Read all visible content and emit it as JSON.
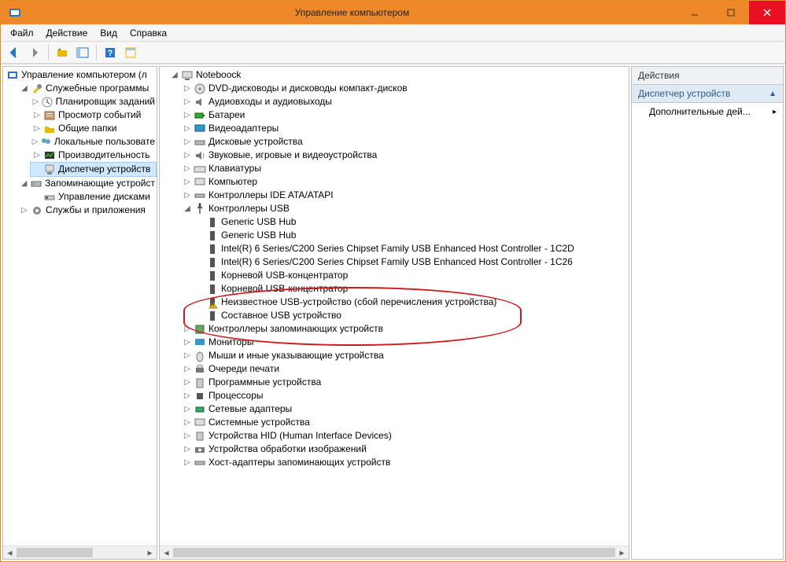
{
  "window": {
    "title": "Управление компьютером"
  },
  "menubar": {
    "file": "Файл",
    "action": "Действие",
    "view": "Вид",
    "help": "Справка"
  },
  "left_tree": {
    "root": "Управление компьютером (л",
    "sys_tools": "Служебные программы",
    "scheduler": "Планировщик заданий",
    "eventviewer": "Просмотр событий",
    "shared": "Общие папки",
    "localusers": "Локальные пользовате",
    "perf": "Производительность",
    "devmgr": "Диспетчер устройств",
    "storage": "Запоминающие устройст",
    "diskmgmt": "Управление дисками",
    "services": "Службы и приложения"
  },
  "device_tree": {
    "root": "Noteboock",
    "dvd": "DVD-дисководы и дисководы компакт-дисков",
    "audio": "Аудиовходы и аудиовыходы",
    "battery": "Батареи",
    "video": "Видеоадаптеры",
    "disk": "Дисковые устройства",
    "sound": "Звуковые, игровые и видеоустройства",
    "keyboard": "Клавиатуры",
    "computer": "Компьютер",
    "ide": "Контроллеры IDE ATA/ATAPI",
    "usb": "Контроллеры USB",
    "usb_items": {
      "hub1": "Generic USB Hub",
      "hub2": "Generic USB Hub",
      "intel1": "Intel(R) 6 Series/C200 Series Chipset Family USB Enhanced Host Controller - 1C2D",
      "intel2": "Intel(R) 6 Series/C200 Series Chipset Family USB Enhanced Host Controller - 1C26",
      "roothub1": "Корневой USB-концентратор",
      "roothub2": "Корневой USB-концентратор",
      "unknown": "Неизвестное USB-устройство (сбой перечисления устройства)",
      "composite": "Составное USB устройство"
    },
    "storagectrl": "Контроллеры запоминающих устройств",
    "monitors": "Мониторы",
    "mice": "Мыши и иные указывающие устройства",
    "printq": "Очереди печати",
    "software": "Программные устройства",
    "cpu": "Процессоры",
    "net": "Сетевые адаптеры",
    "system": "Системные устройства",
    "hid": "Устройства HID (Human Interface Devices)",
    "imaging": "Устройства обработки изображений",
    "hostadapter": "Хост-адаптеры запоминающих устройств"
  },
  "actions_panel": {
    "header": "Действия",
    "section": "Диспетчер устройств",
    "more": "Дополнительные дей..."
  }
}
